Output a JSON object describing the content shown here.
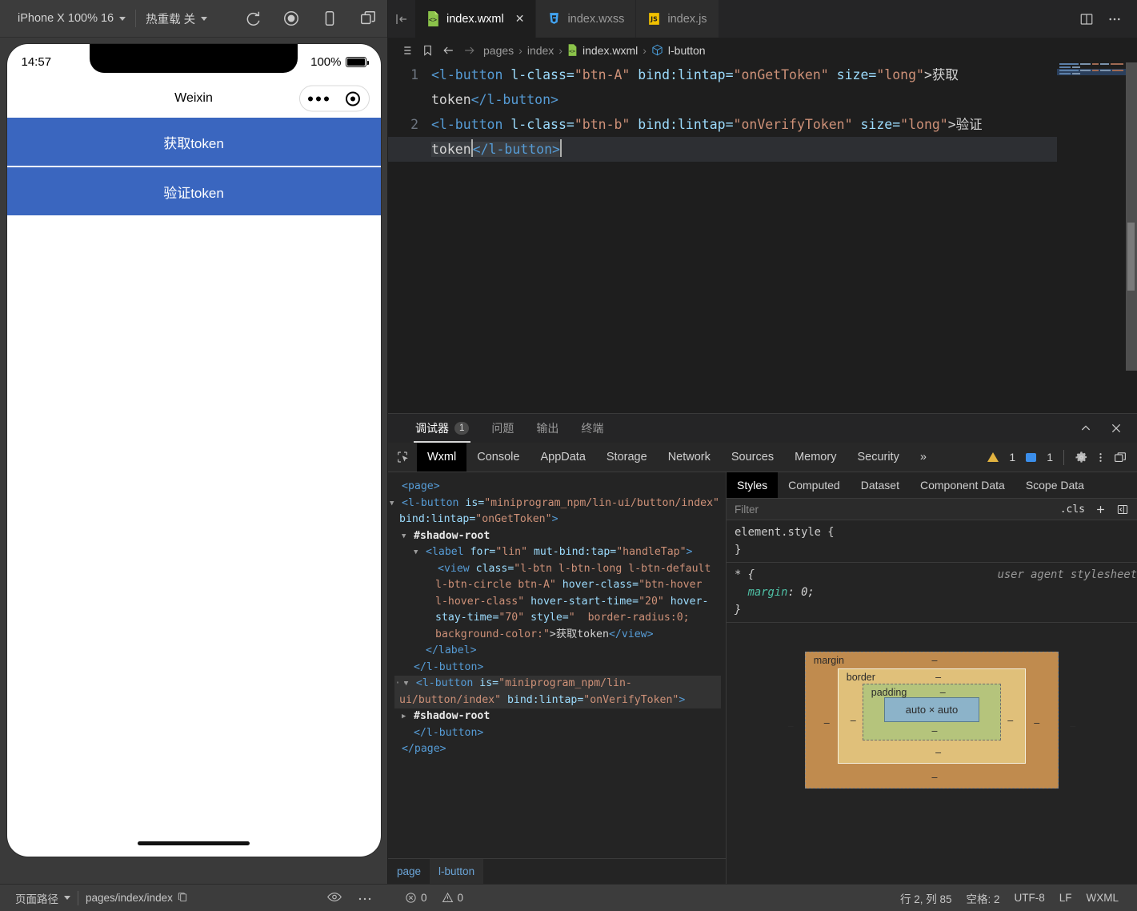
{
  "simulator_toolbar": {
    "device": "iPhone X 100% 16",
    "hot_reload": "热重载 关",
    "icons": [
      "refresh-icon",
      "stop-icon",
      "phone-icon",
      "multi-window-icon"
    ]
  },
  "phone": {
    "time": "14:57",
    "battery_percent": "100%",
    "nav_title": "Weixin",
    "buttons": [
      {
        "label": "获取token",
        "color": "#3a66bf"
      },
      {
        "label": "验证token",
        "color": "#3a66bf"
      }
    ]
  },
  "editor": {
    "tabs": [
      {
        "label": "index.wxml",
        "icon": "wxml-file-icon",
        "active": true,
        "closable": true
      },
      {
        "label": "index.wxss",
        "icon": "wxss-file-icon",
        "active": false,
        "closable": false
      },
      {
        "label": "index.js",
        "icon": "js-file-icon",
        "active": false,
        "closable": false
      }
    ],
    "tabbar_actions": [
      "split-editor-icon",
      "more-actions-icon"
    ],
    "breadcrumb": {
      "icons": [
        "outline-icon",
        "bookmark-icon",
        "back-arrow-icon",
        "forward-arrow-icon"
      ],
      "segments": [
        "pages",
        "index",
        "index.wxml",
        "l-button"
      ]
    },
    "lines": [
      {
        "number": "1",
        "segments": [
          {
            "t": "<l-button ",
            "c": "tag"
          },
          {
            "t": "l-class=",
            "c": "attr"
          },
          {
            "t": "\"btn-A\"",
            "c": "str"
          },
          {
            "t": " bind:lintap=",
            "c": "attr"
          },
          {
            "t": "\"onGetToken\"",
            "c": "str"
          },
          {
            "t": " size=",
            "c": "attr"
          },
          {
            "t": "\"long\"",
            "c": "str"
          },
          {
            "t": ">获取",
            "c": "txt"
          }
        ],
        "wrap_segments": [
          {
            "t": "token",
            "c": "txt"
          },
          {
            "t": "</l-button>",
            "c": "tag"
          }
        ]
      },
      {
        "number": "2",
        "segments": [
          {
            "t": "<l-button ",
            "c": "tag"
          },
          {
            "t": "l-class=",
            "c": "attr"
          },
          {
            "t": "\"btn-b\"",
            "c": "str"
          },
          {
            "t": " bind:lintap=",
            "c": "attr"
          },
          {
            "t": "\"onVerifyToken\"",
            "c": "str"
          },
          {
            "t": " size=",
            "c": "attr"
          },
          {
            "t": "\"long\"",
            "c": "str"
          },
          {
            "t": ">验证",
            "c": "txt"
          }
        ],
        "wrap_segments": [
          {
            "t": "token",
            "c": "txt"
          },
          {
            "t": "</l-button>",
            "c": "tag"
          }
        ]
      }
    ]
  },
  "devtools": {
    "panel_tabs": [
      {
        "label": "调试器",
        "badge": "1",
        "active": true
      },
      {
        "label": "问题",
        "badge": "",
        "active": false
      },
      {
        "label": "输出",
        "badge": "",
        "active": false
      },
      {
        "label": "终端",
        "badge": "",
        "active": false
      }
    ],
    "panel_actions": [
      "collapse-icon",
      "close-icon"
    ],
    "inspector_tabs": [
      {
        "label": "Wxml",
        "active": true
      },
      {
        "label": "Console",
        "active": false
      },
      {
        "label": "AppData",
        "active": false
      },
      {
        "label": "Storage",
        "active": false
      },
      {
        "label": "Network",
        "active": false
      },
      {
        "label": "Sources",
        "active": false
      },
      {
        "label": "Memory",
        "active": false
      },
      {
        "label": "Security",
        "active": false
      }
    ],
    "overflow_label": "»",
    "warning_count": "1",
    "message_count": "1",
    "toolbar_icons": [
      "settings-gear-icon",
      "more-vertical-icon",
      "dock-side-icon"
    ],
    "wxml_tree": [
      {
        "indent": 0,
        "tri": "",
        "parts": [
          {
            "t": "<page>",
            "c": "tg"
          }
        ]
      },
      {
        "indent": 0,
        "tri": "▼",
        "parts": [
          {
            "t": "<l-button ",
            "c": "tg"
          },
          {
            "t": "is=",
            "c": "at"
          },
          {
            "t": "\"miniprogram_npm/lin-ui/button/index\"",
            "c": "av"
          },
          {
            "t": " bind:lintap=",
            "c": "at"
          },
          {
            "t": "\"onGetToken\"",
            "c": "av"
          },
          {
            "t": ">",
            "c": "tg"
          }
        ]
      },
      {
        "indent": 1,
        "tri": "▼",
        "parts": [
          {
            "t": "#shadow-root",
            "c": "sh"
          }
        ]
      },
      {
        "indent": 2,
        "tri": "▼",
        "parts": [
          {
            "t": "<label ",
            "c": "tg"
          },
          {
            "t": "for=",
            "c": "at"
          },
          {
            "t": "\"lin\"",
            "c": "av"
          },
          {
            "t": " mut-bind:tap=",
            "c": "at"
          },
          {
            "t": "\"handleTap\"",
            "c": "av"
          },
          {
            "t": ">",
            "c": "tg"
          }
        ]
      },
      {
        "indent": 3,
        "tri": "",
        "parts": [
          {
            "t": "<view ",
            "c": "tg"
          },
          {
            "t": "class=",
            "c": "at"
          },
          {
            "t": "\"l-btn l-btn-long l-btn-default l-btn-circle btn-A\"",
            "c": "av"
          },
          {
            "t": " hover-class=",
            "c": "at"
          },
          {
            "t": "\"btn-hover l-hover-class\"",
            "c": "av"
          },
          {
            "t": " hover-start-time=",
            "c": "at"
          },
          {
            "t": "\"20\"",
            "c": "av"
          },
          {
            "t": " hover-stay-time=",
            "c": "at"
          },
          {
            "t": "\"70\"",
            "c": "av"
          },
          {
            "t": " style=",
            "c": "at"
          },
          {
            "t": "\"  border-radius:0; background-color:\"",
            "c": "av"
          },
          {
            "t": ">获取token",
            "c": "tx"
          },
          {
            "t": "</view>",
            "c": "tg"
          }
        ]
      },
      {
        "indent": 2,
        "tri": "",
        "parts": [
          {
            "t": "</label>",
            "c": "tg"
          }
        ]
      },
      {
        "indent": 1,
        "tri": "",
        "parts": [
          {
            "t": "</l-button>",
            "c": "tg"
          }
        ]
      },
      {
        "indent": 0,
        "tri": "▼",
        "hl": true,
        "dots": true,
        "parts": [
          {
            "t": "<l-button ",
            "c": "tg"
          },
          {
            "t": "is=",
            "c": "at"
          },
          {
            "t": "\"miniprogram_npm/lin-ui/button/index\"",
            "c": "av"
          },
          {
            "t": " bind:lintap=",
            "c": "at"
          },
          {
            "t": "\"onVerifyToken\"",
            "c": "av"
          },
          {
            "t": ">",
            "c": "tg"
          }
        ]
      },
      {
        "indent": 1,
        "tri": "▶",
        "parts": [
          {
            "t": "#shadow-root",
            "c": "sh"
          }
        ]
      },
      {
        "indent": 1,
        "tri": "",
        "parts": [
          {
            "t": "</l-button>",
            "c": "tg"
          }
        ]
      },
      {
        "indent": 0,
        "tri": "",
        "parts": [
          {
            "t": "</page>",
            "c": "tg"
          }
        ]
      }
    ],
    "wxml_breadcrumb": [
      {
        "label": "page",
        "active": false
      },
      {
        "label": "l-button",
        "active": true
      }
    ],
    "styles": {
      "tabs": [
        {
          "label": "Styles",
          "active": true
        },
        {
          "label": "Computed",
          "active": false
        },
        {
          "label": "Dataset",
          "active": false
        },
        {
          "label": "Component Data",
          "active": false
        },
        {
          "label": "Scope Data",
          "active": false
        }
      ],
      "filter_placeholder": "Filter",
      "filter_value": "",
      "cls_label": ".cls",
      "add_rule_icon": "plus-icon",
      "toggle_sidebar_icon": "panel-toggle-icon",
      "rules": [
        {
          "selector": "element.style {",
          "origin": "",
          "decls": [],
          "close": "}"
        },
        {
          "selector": "* {",
          "origin": "user agent stylesheet",
          "decls": [
            {
              "name": "margin",
              "value": "0;"
            }
          ],
          "close": "}"
        }
      ],
      "box_model": {
        "margin_label": "margin",
        "border_label": "border",
        "padding_label": "padding",
        "content": "auto × auto",
        "dash": "–"
      }
    }
  },
  "statusbar": {
    "page_path_label": "页面路径",
    "page_path_value": "pages/index/index",
    "copy_icon": "copy-icon",
    "eye_icon": "eye-icon",
    "more_icon": "more-icon",
    "error_count": "0",
    "warning_count": "0",
    "cursor": "行 2, 列 85",
    "indent": "空格: 2",
    "encoding": "UTF-8",
    "eol": "LF",
    "language": "WXML"
  }
}
